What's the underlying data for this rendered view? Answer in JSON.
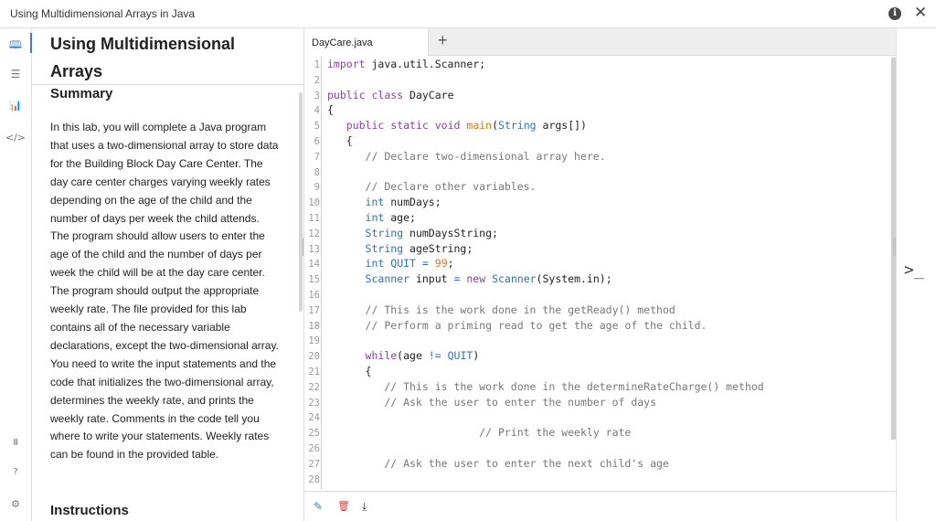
{
  "window": {
    "title": "Using Multidimensional Arrays in Java",
    "info_glyph": "i",
    "close_glyph": "✕"
  },
  "nav": {
    "icons": [
      {
        "name": "book-icon",
        "glyph": "🕮"
      },
      {
        "name": "list-icon",
        "glyph": "☰"
      },
      {
        "name": "chart-icon",
        "glyph": "📊"
      },
      {
        "name": "code-icon",
        "glyph": "</>"
      },
      {
        "name": "share-icon",
        "glyph": "⩩"
      },
      {
        "name": "help-icon",
        "glyph": "?"
      },
      {
        "name": "settings-icon",
        "glyph": "⚙"
      }
    ]
  },
  "lab": {
    "title": "Using Multidimensional Arrays",
    "summary_heading": "Summary",
    "summary_text": "In this lab, you will complete a Java program that uses a two-dimensional array to store data for the Building Block Day Care Center. The day care center charges varying weekly rates depending on the age of the child and the number of days per week the child attends. The program should allow users to enter the age of the child and the number of days per week the child will be at the day care center. The program should output the appropriate weekly rate. The file provided for this lab contains all of the necessary variable declarations, except the two-dimensional array. You need to write the input statements and the code that initializes the two-dimensional array, determines the weekly rate, and prints the weekly rate. Comments in the code tell you where to write your statements. Weekly rates can be found in the provided table.",
    "instructions_heading": "Instructions"
  },
  "editor": {
    "tab_label": "DayCare.java",
    "add_tab_glyph": "+",
    "lines": [
      {
        "n": "1",
        "code": "import java.util.Scanner;"
      },
      {
        "n": "2",
        "code": ""
      },
      {
        "n": "3",
        "code": "public class DayCare"
      },
      {
        "n": "4",
        "code": "{"
      },
      {
        "n": "5",
        "code": "   public static void main(String args[])"
      },
      {
        "n": "6",
        "code": "   {"
      },
      {
        "n": "7",
        "code": "      // Declare two-dimensional array here."
      },
      {
        "n": "8",
        "code": ""
      },
      {
        "n": "9",
        "code": "      // Declare other variables."
      },
      {
        "n": "10",
        "code": "      int numDays;"
      },
      {
        "n": "11",
        "code": "      int age;"
      },
      {
        "n": "12",
        "code": "      String numDaysString;"
      },
      {
        "n": "13",
        "code": "      String ageString;"
      },
      {
        "n": "14",
        "code": "      int QUIT = 99;"
      },
      {
        "n": "15",
        "code": "      Scanner input = new Scanner(System.in);"
      },
      {
        "n": "16",
        "code": ""
      },
      {
        "n": "17",
        "code": "      // This is the work done in the getReady() method"
      },
      {
        "n": "18",
        "code": "      // Perform a priming read to get the age of the child."
      },
      {
        "n": "19",
        "code": ""
      },
      {
        "n": "20",
        "code": "      while(age != QUIT)"
      },
      {
        "n": "21",
        "code": "      {"
      },
      {
        "n": "22",
        "code": "         // This is the work done in the determineRateCharge() method"
      },
      {
        "n": "23",
        "code": "         // Ask the user to enter the number of days"
      },
      {
        "n": "24",
        "code": ""
      },
      {
        "n": "25",
        "code": "                        // Print the weekly rate"
      },
      {
        "n": "26",
        "code": ""
      },
      {
        "n": "27",
        "code": "         // Ask the user to enter the next child's age"
      },
      {
        "n": "28",
        "code": ""
      }
    ],
    "tools": {
      "edit_glyph": "✎",
      "delete_glyph": "🗑",
      "download_glyph": "⤓"
    }
  },
  "terminal": {
    "prompt_glyph": ">_"
  },
  "colors": {
    "accent": "#3a7ec8",
    "keyword": "#8b3fa8",
    "type": "#2f6fb5",
    "method": "#c27a16",
    "number": "#e0722a",
    "comment": "#777777",
    "delete": "#e03b3b"
  }
}
